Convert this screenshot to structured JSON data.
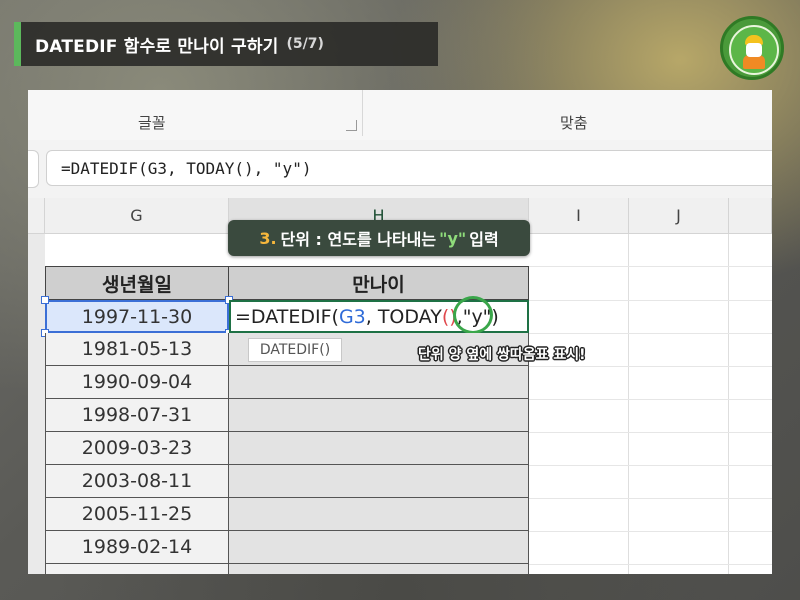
{
  "title": {
    "main": "DATEDIF 함수로 만나이 구하기",
    "step": "(5/7)"
  },
  "logo": {
    "icon": "character-logo-icon"
  },
  "ribbon": {
    "font_group": "글꼴",
    "align_group": "맞춤"
  },
  "formula_bar": {
    "value": "=DATEDIF(G3, TODAY(), \"y\")"
  },
  "columns": [
    "G",
    "H",
    "I",
    "J"
  ],
  "callout": {
    "number": "3.",
    "text_before": "단위 : 연도를 나타내는",
    "quoted": "\"y\"",
    "text_after": "입력"
  },
  "table": {
    "header_birth": "생년월일",
    "header_age": "만나이",
    "dates": [
      "1997-11-30",
      "1981-05-13",
      "1990-09-04",
      "1998-07-31",
      "2009-03-23",
      "2003-08-11",
      "2005-11-25",
      "1989-02-14"
    ]
  },
  "edit_cell": {
    "prefix": "=DATEDIF(",
    "ref": "G3",
    "mid": ", TODAY",
    "paren": "()",
    "comma": ",",
    "arg": "\"y\")"
  },
  "tooltip": "DATEDIF()",
  "note": "단위 양 옆에 쌍따옴표 표시!",
  "colors": {
    "accent_green": "#5cb85c",
    "selection_blue": "#3b6fd6",
    "edit_border": "#1e7145",
    "callout_number": "#f6b73c"
  }
}
